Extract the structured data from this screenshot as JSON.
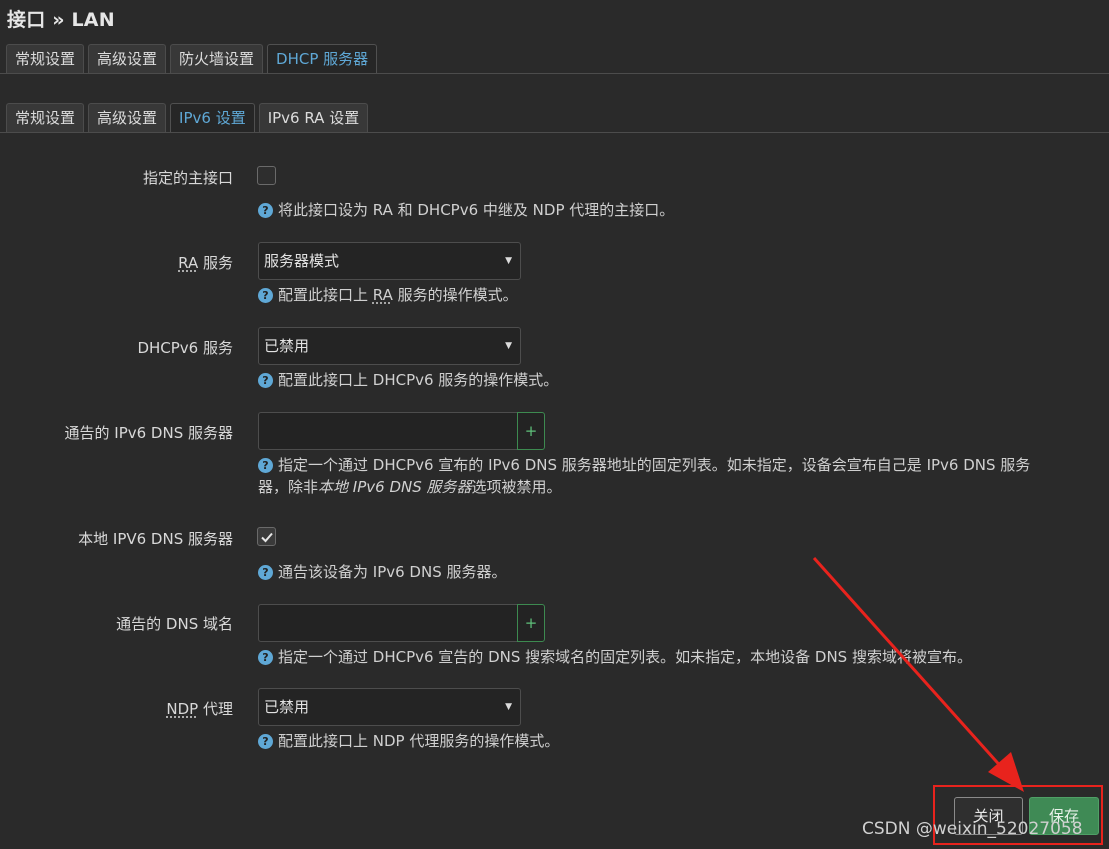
{
  "page": {
    "title": "接口 » LAN"
  },
  "tabs_main": [
    {
      "label": "常规设置"
    },
    {
      "label": "高级设置"
    },
    {
      "label": "防火墙设置"
    },
    {
      "label": "DHCP 服务器"
    }
  ],
  "tabs_sub": [
    {
      "label": "常规设置"
    },
    {
      "label": "高级设置"
    },
    {
      "label": "IPv6 设置"
    },
    {
      "label": "IPv6 RA 设置"
    }
  ],
  "form": {
    "master": {
      "label": "指定的主接口",
      "checked": false,
      "help": "将此接口设为 RA 和 DHCPv6 中继及 NDP 代理的主接口。"
    },
    "ra": {
      "label_abbr": "RA",
      "label_rest": " 服务",
      "value": "服务器模式",
      "help_pre": "配置此接口上 ",
      "help_abbr": "RA",
      "help_post": " 服务的操作模式。"
    },
    "dhcpv6": {
      "label": "DHCPv6 服务",
      "value": "已禁用",
      "help": "配置此接口上 DHCPv6 服务的操作模式。"
    },
    "dns": {
      "label": "通告的 IPv6 DNS 服务器",
      "value": "",
      "add": "+",
      "help_pre": "指定一个通过 DHCPv6 宣布的 IPv6 DNS 服务器地址的固定列表。如未指定，设备会宣布自己是 IPv6 DNS 服务",
      "help_line2_pre": "器，除非",
      "help_em": "本地 IPv6 DNS 服务器",
      "help_post": "选项被禁用。"
    },
    "local_dns": {
      "label": "本地 IPV6 DNS 服务器",
      "checked": true,
      "help": "通告该设备为 IPv6 DNS 服务器。"
    },
    "domain": {
      "label": "通告的 DNS 域名",
      "value": "",
      "add": "+",
      "help": "指定一个通过 DHCPv6 宣告的 DNS 搜索域名的固定列表。如未指定，本地设备 DNS 搜索域将被宣布。"
    },
    "ndp": {
      "label_abbr": "NDP",
      "label_rest": " 代理",
      "value": "已禁用",
      "help": "配置此接口上 NDP 代理服务的操作模式。"
    }
  },
  "help_icon": "question-circle-icon",
  "buttons": {
    "close": "关闭",
    "save": "保存"
  },
  "annotation_color": "#e8231d",
  "watermark": "CSDN @weixin_52027058"
}
